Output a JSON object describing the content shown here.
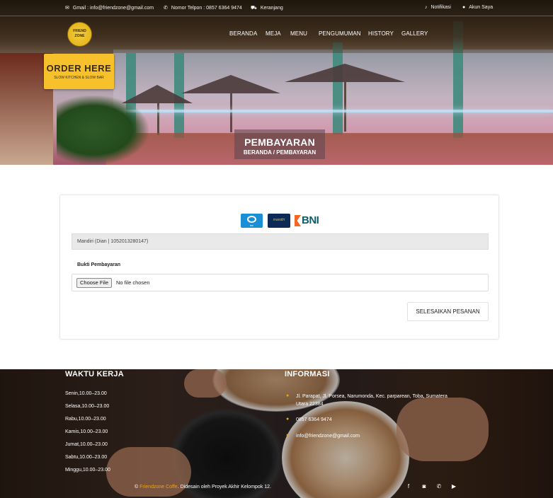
{
  "topbar": {
    "email": "Gmail : info@friendzone@gmail.com",
    "phone": "Nomor Telpon : 0857 6364 9474",
    "cart": "Keranjang",
    "notif": "Notifikasi",
    "account": "Akun Saya"
  },
  "logo": {
    "line1": "FRIEND",
    "line2": "ZONE"
  },
  "nav": {
    "items": [
      "BERANDA",
      "MEJA",
      "MENU",
      "PENGUMUMAN",
      "HISTORY",
      "GALLERY"
    ]
  },
  "hero_sign": {
    "big": "ORDER HERE",
    "small": "SLOW KITCHEN & SLOW BAR"
  },
  "banner": {
    "title": "PEMBAYARAN",
    "breadcrumb": "BERANDA / PEMBAYARAN"
  },
  "payment": {
    "banks": [
      {
        "name": "BRI",
        "icon": "bri-logo-icon"
      },
      {
        "name": "mandiri",
        "icon": "mandiri-logo-icon"
      },
      {
        "name": "BNI",
        "icon": "bni-logo-icon"
      }
    ],
    "account_text": "Mandiri (Dian | 1052013280147)",
    "proof_label": "Bukti Pembayaran",
    "choose_file": "Choose File",
    "no_file": "No file chosen",
    "submit": "SELESAIKAN PESANAN"
  },
  "footer": {
    "hours_title": "WAKTU KERJA",
    "hours": [
      "Senin,10.00–23.00",
      "Selasa,10.00–23.00",
      "Rabu,10.00–23.00",
      "Kamis,10.00–23.00",
      "Jumat,10.00–23.00",
      "Sabtu,10.00–23.00",
      "Minggu,10.00–23.00"
    ],
    "info_title": "INFORMASI",
    "address_line1": "Jl. Parapat, Jl. Porsea, Narumonda, Kec. parparean, Toba, Sumatera",
    "address_line2": "Utara 22384",
    "phone": "0857 6364 9474",
    "email": "info@friendzone@gmail.com",
    "copy_prefix": "©",
    "copy_brand": "Friendzone Coffe",
    "copy_suffix": ". Didesain oleh Proyek Akhir Kelompok 12.",
    "accent": "#f0a30a"
  }
}
